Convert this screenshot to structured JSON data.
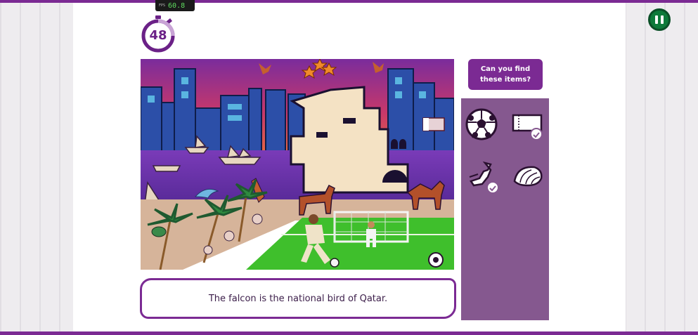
{
  "fps": {
    "label": "FPS",
    "value": "60.8"
  },
  "timer": {
    "seconds": "48"
  },
  "pause": {
    "icon": "pause-icon"
  },
  "find_panel": {
    "title_line1": "Can you find",
    "title_line2": "these items?",
    "items": [
      {
        "name": "football",
        "found": false
      },
      {
        "name": "scarf",
        "found": true
      },
      {
        "name": "falcon",
        "found": true
      },
      {
        "name": "seashell",
        "found": false
      }
    ]
  },
  "fact": {
    "text": "The falcon is the national bird of Qatar."
  },
  "colors": {
    "brand_purple": "#7b2a93",
    "panel_purple": "#85588f",
    "pause_green": "#0d7a3a",
    "pitch_green": "#3fbf2c"
  }
}
